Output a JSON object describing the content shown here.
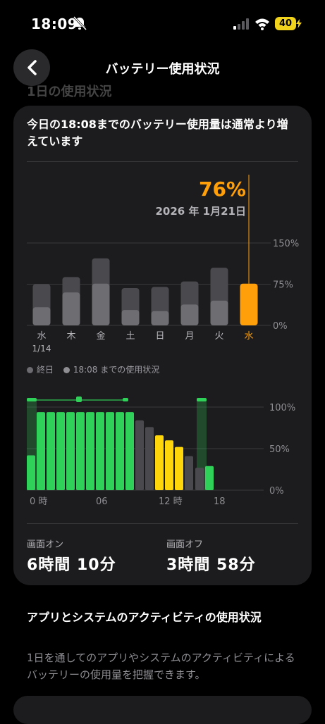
{
  "status": {
    "time": "18:09",
    "battery": "40"
  },
  "nav": {
    "title": "バッテリー使用状況"
  },
  "section_ghost": "1日の使用状況",
  "card": {
    "headline": "今日の18:08までのバッテリー使用量は通常より増えています",
    "legend": {
      "full_day": "終日",
      "until_now": "18:08 までの使用状況"
    },
    "screen_on_label": "画面オン",
    "screen_on_value": "6時間 10分",
    "screen_off_label": "画面オフ",
    "screen_off_value": "3時間 58分"
  },
  "chart_data": [
    {
      "type": "bar",
      "callout": {
        "value": "76%",
        "date": "2026 年 1月21日"
      },
      "categories": [
        "水",
        "木",
        "金",
        "土",
        "日",
        "月",
        "火",
        "水"
      ],
      "category_sublabels": [
        "1/14",
        "",
        "",
        "",
        "",
        "",
        "",
        ""
      ],
      "y_tick_labels": [
        "150%",
        "75%",
        "0%"
      ],
      "ylim": [
        0,
        150
      ],
      "series": [
        {
          "name": "終日",
          "values": [
            75,
            88,
            122,
            68,
            70,
            80,
            105,
            76
          ]
        },
        {
          "name": "18:08 までの使用状況",
          "values": [
            33,
            60,
            76,
            28,
            26,
            38,
            45,
            76
          ]
        }
      ],
      "highlight_index": 7,
      "colors": {
        "full_day": "#4a4a4e",
        "until_now": "#6e6e72",
        "highlight": "#ff9f0a"
      }
    },
    {
      "type": "bar",
      "x_tick_labels": [
        "0 時",
        "06",
        "12 時",
        "18"
      ],
      "y_tick_labels": [
        "100%",
        "50%",
        "0%"
      ],
      "ylim": [
        0,
        100
      ],
      "hours": [
        0,
        1,
        2,
        3,
        4,
        5,
        6,
        7,
        8,
        9,
        10,
        11,
        12,
        13,
        14,
        15,
        16,
        17
      ],
      "values": [
        42,
        94,
        94,
        94,
        94,
        94,
        94,
        94,
        94,
        94,
        94,
        84,
        76,
        66,
        60,
        52,
        41,
        27,
        29
      ],
      "bar_states": [
        "charging",
        "charging",
        "charging",
        "charging",
        "charging",
        "charging",
        "charging",
        "charging",
        "charging",
        "charging",
        "charging",
        "gray",
        "gray",
        "yellow",
        "yellow",
        "yellow",
        "gray",
        "gray",
        "charging",
        "yellow"
      ],
      "colors": {
        "charging": "#30d158",
        "gray": "#4a4a4e",
        "low_power": "#ffd60a"
      }
    }
  ],
  "activity": {
    "title": "アプリとシステムのアクティビティの使用状況",
    "description": "1日を通してのアプリやシステムのアクティビティによるバッテリーの使用量を把握できます。"
  }
}
